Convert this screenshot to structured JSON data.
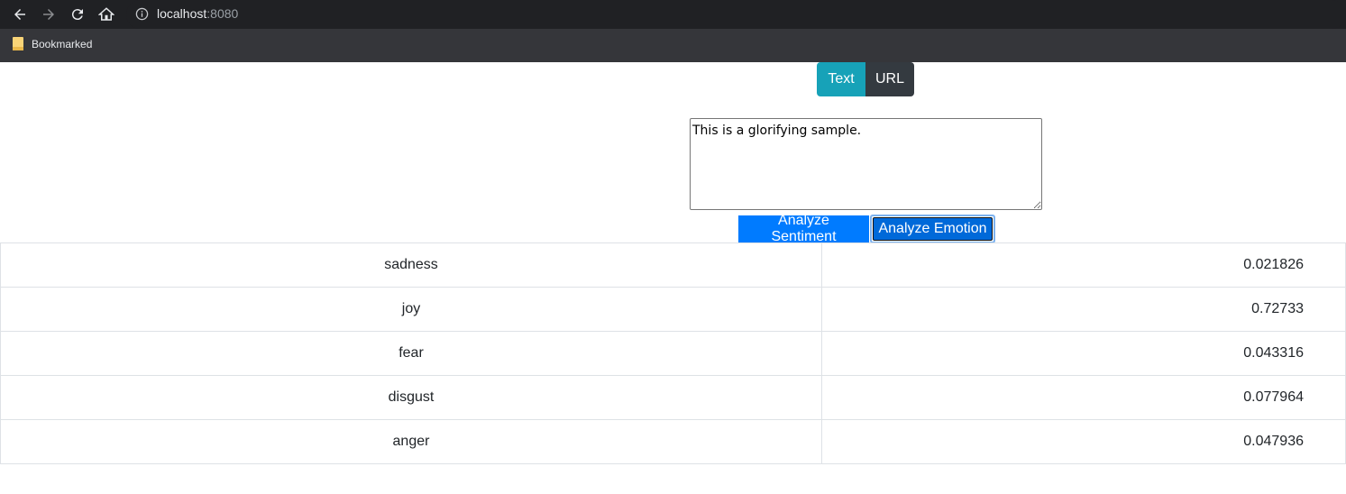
{
  "browser": {
    "url_host": "localhost",
    "url_port": ":8080",
    "bookmark_label": "Bookmarked"
  },
  "mode_toggle": {
    "text_label": "Text",
    "url_label": "URL",
    "active": "Text"
  },
  "input": {
    "value": "This is a glorifying sample."
  },
  "actions": {
    "sentiment_label": "Analyze Sentiment",
    "emotion_label": "Analyze Emotion"
  },
  "results": [
    {
      "emotion": "sadness",
      "score": "0.021826"
    },
    {
      "emotion": "joy",
      "score": "0.72733"
    },
    {
      "emotion": "fear",
      "score": "0.043316"
    },
    {
      "emotion": "disgust",
      "score": "0.077964"
    },
    {
      "emotion": "anger",
      "score": "0.047936"
    }
  ],
  "colors": {
    "text_toggle": "#17a2b8",
    "url_toggle": "#343a40",
    "primary": "#007bff"
  }
}
